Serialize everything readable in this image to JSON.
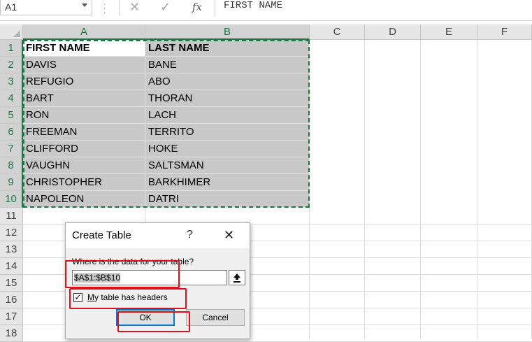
{
  "formula_bar": {
    "name_box": "A1",
    "cancel_icon": "✕",
    "enter_icon": "✓",
    "function_icon": "fx",
    "content": "FIRST NAME"
  },
  "columns": [
    "A",
    "B",
    "C",
    "D",
    "E",
    "F"
  ],
  "rows": [
    "1",
    "2",
    "3",
    "4",
    "5",
    "6",
    "7",
    "8",
    "9",
    "10",
    "11",
    "12",
    "13",
    "14",
    "15",
    "16",
    "17",
    "18"
  ],
  "table": {
    "headers": [
      "FIRST NAME",
      "LAST NAME"
    ],
    "rows": [
      [
        "DAVIS",
        "BANE"
      ],
      [
        "REFUGIO",
        "ABO"
      ],
      [
        "BART",
        "THORAN"
      ],
      [
        "RON",
        "LACH"
      ],
      [
        "FREEMAN",
        "TERRITO"
      ],
      [
        "CLIFFORD",
        "HOKE"
      ],
      [
        "VAUGHN",
        "SALTSMAN"
      ],
      [
        "CHRISTOPHER",
        "BARKHIMER"
      ],
      [
        "NAPOLEON",
        "DATRI"
      ]
    ]
  },
  "dialog": {
    "title": "Create Table",
    "help": "?",
    "close": "✕",
    "prompt": "Where is the data for your table?",
    "range_value": "$A$1:$B$10",
    "checkbox_checked": true,
    "checkbox_mark": "✓",
    "checkbox_label_accel": "M",
    "checkbox_label_rest": "y table has headers",
    "ok_label": "OK",
    "cancel_label": "Cancel"
  },
  "colors": {
    "selection_accent": "#217346",
    "annotation_red": "#e0101b",
    "default_button_border": "#0078d7"
  }
}
